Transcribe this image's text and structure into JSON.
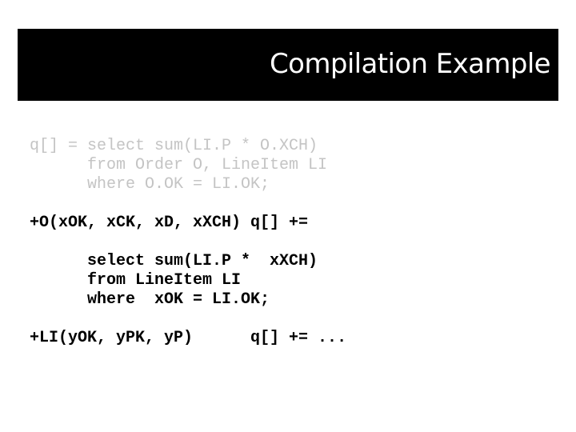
{
  "slide": {
    "title": "Compilation Example",
    "colors": {
      "title_bar_bg": "#000000",
      "title_text": "#ffffff",
      "faded_code": "#c4c4c4",
      "active_code": "#000000"
    }
  },
  "code": {
    "query_block": [
      "q[] = select sum(LI.P * O.XCH)",
      "      from Order O, LineItem LI",
      "      where O.OK = LI.OK;"
    ],
    "order_trigger": {
      "header": "+O(xOK, xCK, xD, xXCH) q[] +=",
      "body": [
        "      select sum(LI.P *  xXCH)",
        "      from LineItem LI",
        "      where  xOK = LI.OK;"
      ]
    },
    "lineitem_trigger": {
      "header": "+LI(yOK, yPK, yP)      q[] += ..."
    }
  }
}
